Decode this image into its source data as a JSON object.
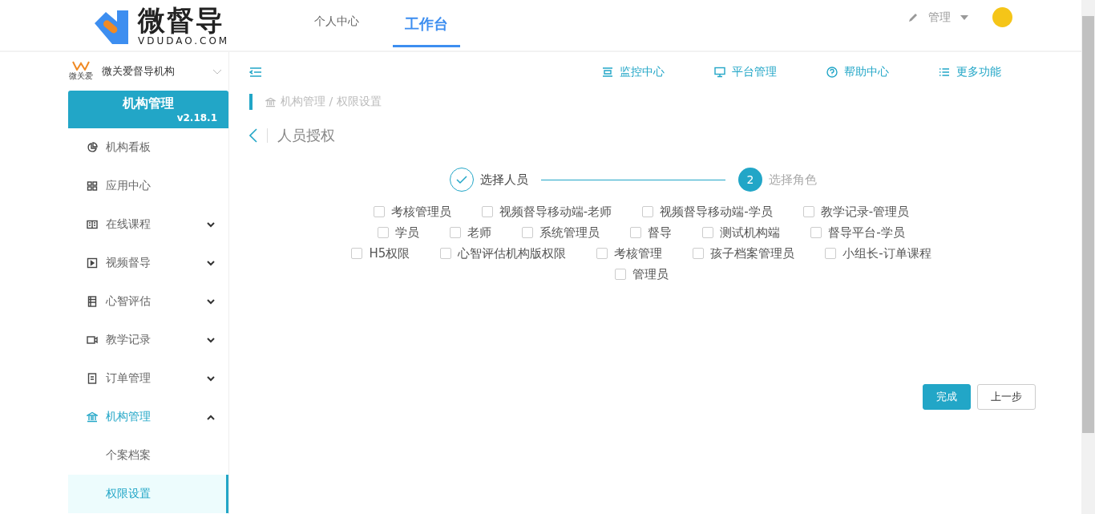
{
  "header": {
    "logo_text": "微督导",
    "logo_sub": "VDUDAO.COM",
    "tabs": [
      {
        "label": "个人中心",
        "selected": false
      },
      {
        "label": "工作台",
        "selected": true
      }
    ],
    "user_menu": "管理"
  },
  "sidebar": {
    "org_logo_text": "微关爱",
    "org_name": "微关爱督导机构",
    "card_title": "机构管理",
    "version": "v2.18.1",
    "items": [
      {
        "label": "机构看板",
        "kind": "pie",
        "selected": false
      },
      {
        "label": "应用中心",
        "kind": "grid",
        "selected": false
      },
      {
        "label": "在线课程",
        "kind": "book",
        "expanded": false,
        "selected": false
      },
      {
        "label": "视频督导",
        "kind": "play",
        "expanded": false,
        "selected": false
      },
      {
        "label": "心智评估",
        "kind": "list",
        "expanded": false,
        "selected": false
      },
      {
        "label": "教学记录",
        "kind": "camera",
        "expanded": false,
        "selected": false
      },
      {
        "label": "订单管理",
        "kind": "doc",
        "expanded": false,
        "selected": false
      },
      {
        "label": "机构管理",
        "kind": "bank",
        "expanded": true,
        "selected": false,
        "children": [
          {
            "label": "个案档案",
            "selected": false
          },
          {
            "label": "权限设置",
            "selected": true
          }
        ]
      }
    ]
  },
  "toolbar": [
    {
      "label": "监控中心",
      "kind": "monitor"
    },
    {
      "label": "平台管理",
      "kind": "screen"
    },
    {
      "label": "帮助中心",
      "kind": "help"
    },
    {
      "label": "更多功能",
      "kind": "more"
    }
  ],
  "breadcrumb": "机构管理 / 权限设置",
  "page_title": "人员授权",
  "steps": [
    {
      "label": "选择人员",
      "done": true
    },
    {
      "label": "选择角色",
      "number": "2",
      "done": false
    }
  ],
  "role_rows": [
    [
      {
        "label": "考核管理员",
        "checked": false
      },
      {
        "label": "视频督导移动端-老师",
        "checked": false
      },
      {
        "label": "视频督导移动端-学员",
        "checked": false
      },
      {
        "label": "教学记录-管理员",
        "checked": false
      }
    ],
    [
      {
        "label": "学员",
        "checked": false
      },
      {
        "label": "老师",
        "checked": false
      },
      {
        "label": "系统管理员",
        "checked": false
      },
      {
        "label": "督导",
        "checked": false
      },
      {
        "label": "测试机构端",
        "checked": false
      },
      {
        "label": "督导平台-学员",
        "checked": false
      }
    ],
    [
      {
        "label": "H5权限",
        "checked": false
      },
      {
        "label": "心智评估机构版权限",
        "checked": false
      },
      {
        "label": "考核管理",
        "checked": false
      },
      {
        "label": "孩子档案管理员",
        "checked": false
      },
      {
        "label": "小组长-订单课程",
        "checked": false
      }
    ],
    [
      {
        "label": "管理员",
        "checked": false
      }
    ]
  ],
  "buttons": [
    {
      "label": "完成",
      "kind": "primary"
    },
    {
      "label": "上一步",
      "kind": "default"
    }
  ]
}
